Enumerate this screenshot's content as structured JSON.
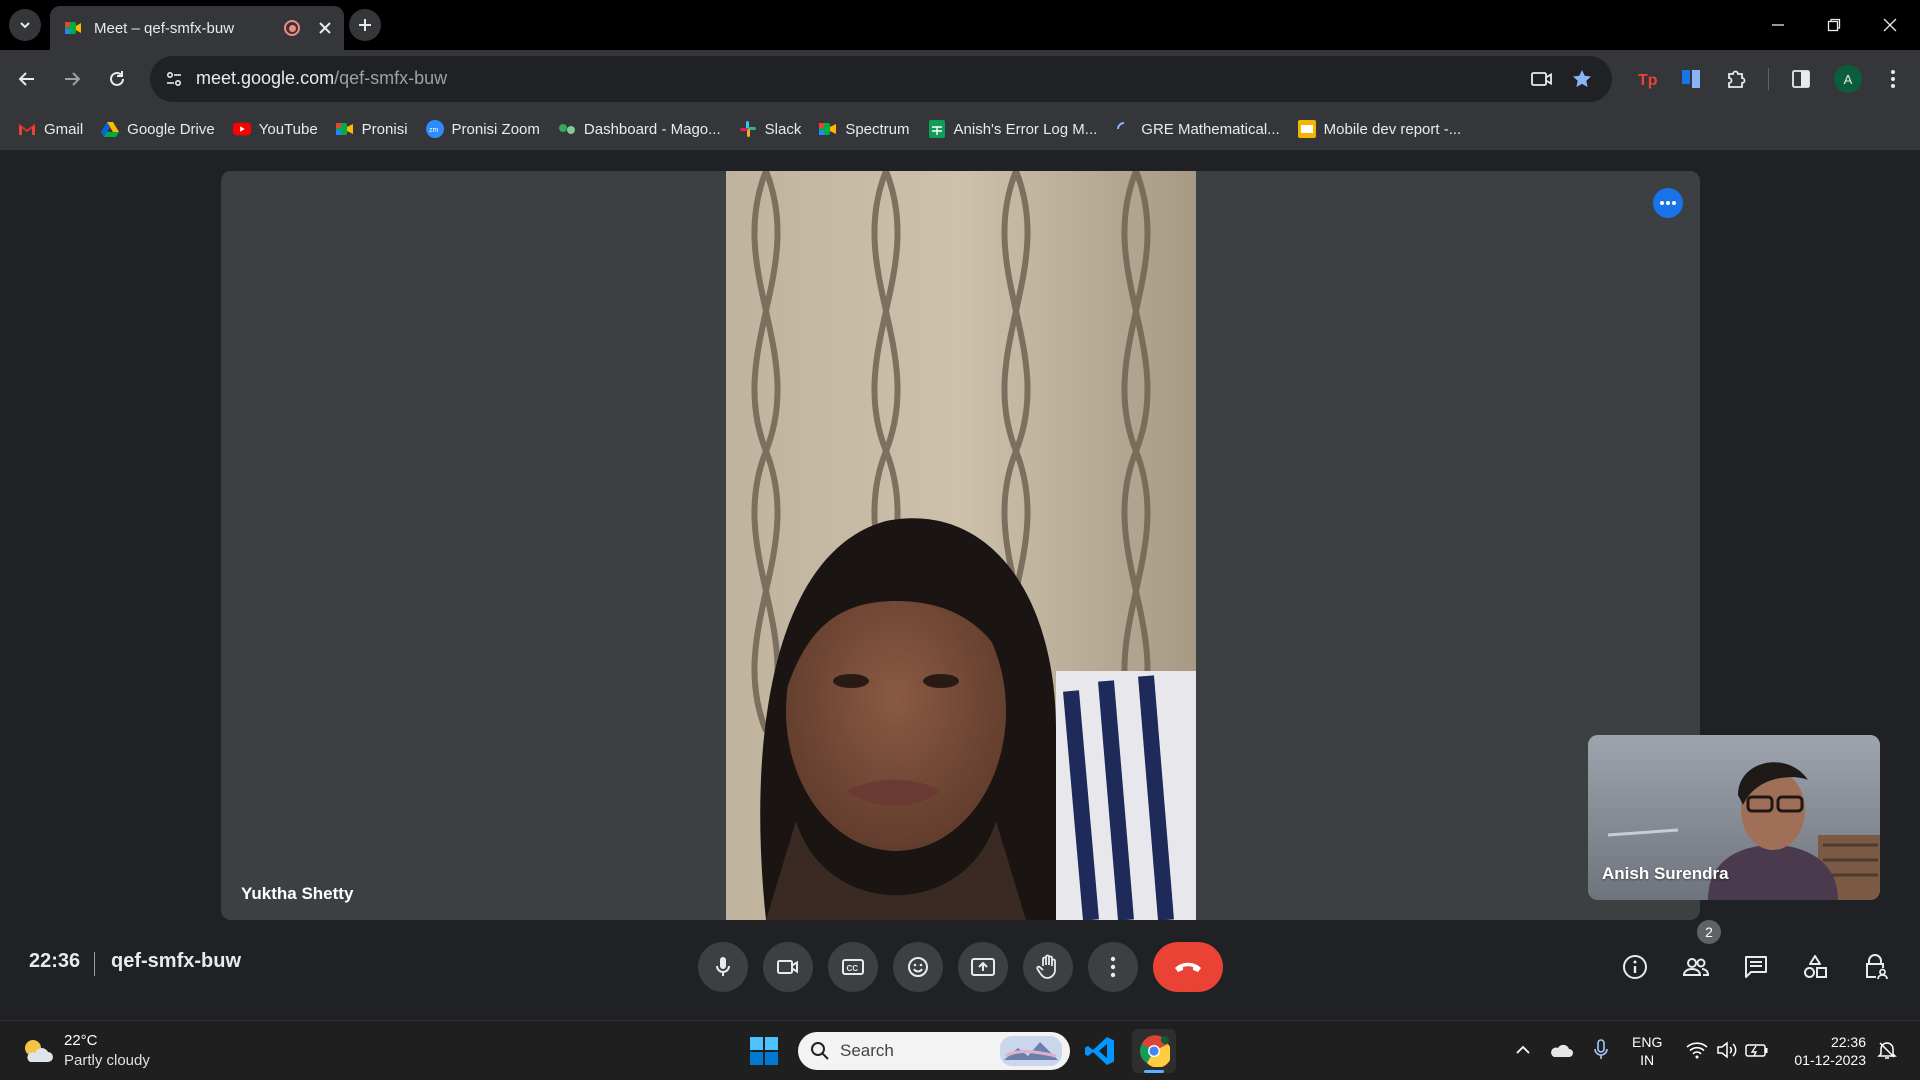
{
  "browser": {
    "tab": {
      "title": "Meet – qef-smfx-buw"
    },
    "url": {
      "host": "meet.google.com",
      "path": "/qef-smfx-buw"
    },
    "profile_initial": "A",
    "bookmarks": [
      {
        "label": "Gmail",
        "icon": "gmail-icon"
      },
      {
        "label": "Google Drive",
        "icon": "google-drive-icon"
      },
      {
        "label": "YouTube",
        "icon": "youtube-icon"
      },
      {
        "label": "Pronisi",
        "icon": "meet-icon"
      },
      {
        "label": "Pronisi Zoom",
        "icon": "zoom-icon"
      },
      {
        "label": "Dashboard - Mago...",
        "icon": "dashboard-icon"
      },
      {
        "label": "Slack",
        "icon": "slack-icon"
      },
      {
        "label": "Spectrum",
        "icon": "meet-icon"
      },
      {
        "label": "Anish's Error Log M...",
        "icon": "sheets-icon"
      },
      {
        "label": "GRE Mathematical...",
        "icon": "loading-icon"
      },
      {
        "label": "Mobile dev report -...",
        "icon": "slides-icon"
      }
    ]
  },
  "meet": {
    "main_participant": "Yuktha Shetty",
    "self_participant": "Anish Surendra",
    "time": "22:36",
    "meeting_code": "qef-smfx-buw",
    "participant_count": "2"
  },
  "taskbar": {
    "weather": {
      "temp": "22°C",
      "condition": "Partly cloudy"
    },
    "search_label": "Search",
    "lang_top": "ENG",
    "lang_bottom": "IN",
    "time": "22:36",
    "date": "01-12-2023"
  },
  "colors": {
    "meet_bg": "#202124",
    "tile_bg": "#3c4043",
    "end_call": "#ea4335",
    "accent_blue": "#1a73e8"
  }
}
